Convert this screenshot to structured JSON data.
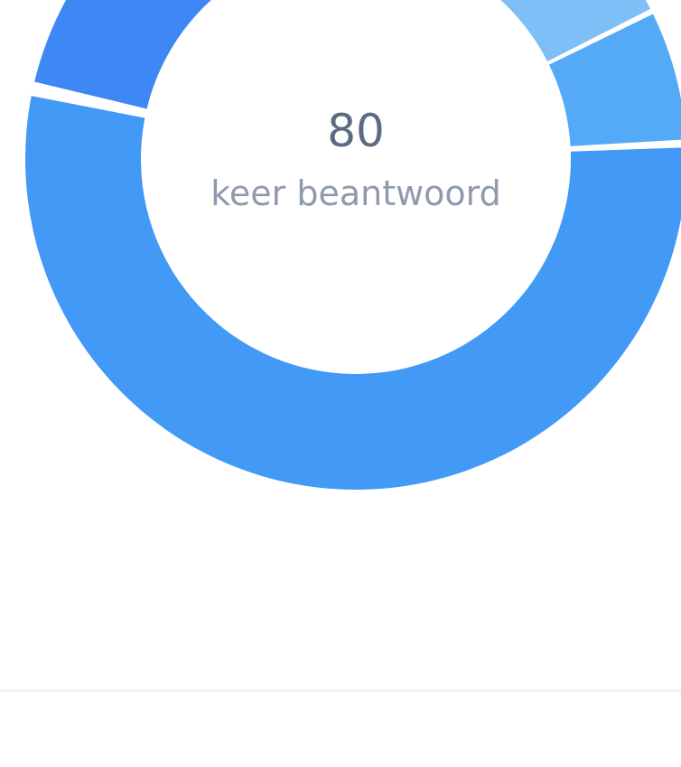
{
  "chart_data": {
    "type": "pie",
    "center_value": "80",
    "center_label": "keer beantwoord",
    "series": [
      {
        "values": [
          80
        ]
      }
    ],
    "colors": {
      "slice_main": "#4299f6",
      "slice_dark": "#3d88f4",
      "slice_mid": "#54aaf7",
      "slice_light": "#7fbff7",
      "center_value": "#5b6b82",
      "center_label": "#8f9bad",
      "divider": "#f0f2f6"
    }
  }
}
